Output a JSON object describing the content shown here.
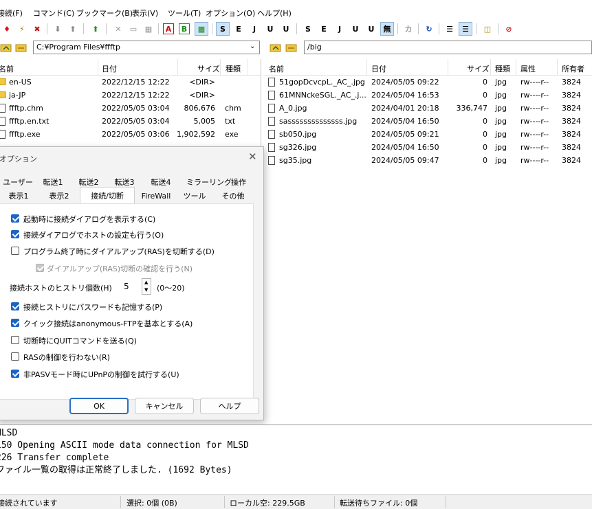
{
  "menu": [
    "接続(F)",
    "コマンド(C)",
    "ブックマーク(B)",
    "表示(V)",
    "ツール(T)",
    "オプション(O)",
    "ヘルプ(H)"
  ],
  "toolbar": {
    "text_buttons": [
      "A",
      "B",
      "S",
      "E",
      "J",
      "U",
      "U",
      "無",
      "カ",
      "S",
      "E",
      "J",
      "U",
      "U"
    ]
  },
  "local_path": "C:¥Program Files¥ffftp",
  "remote_path": "/big",
  "local_pane": {
    "columns": [
      "名前",
      "日付",
      "サイズ",
      "種類"
    ],
    "rows": [
      {
        "name": "en-US",
        "date": "2022/12/15 12:22",
        "size": "<DIR>",
        "type": "",
        "icon": "folder"
      },
      {
        "name": "ja-JP",
        "date": "2022/12/15 12:22",
        "size": "<DIR>",
        "type": "",
        "icon": "folder"
      },
      {
        "name": "ffftp.chm",
        "date": "2022/05/05 03:04",
        "size": "806,676",
        "type": "chm",
        "icon": "file"
      },
      {
        "name": "ffftp.en.txt",
        "date": "2022/05/05 03:04",
        "size": "5,005",
        "type": "txt",
        "icon": "file"
      },
      {
        "name": "ffftp.exe",
        "date": "2022/05/05 03:06",
        "size": "1,902,592",
        "type": "exe",
        "icon": "file"
      }
    ]
  },
  "remote_pane": {
    "columns": [
      "名前",
      "日付",
      "サイズ",
      "種類",
      "属性",
      "所有者"
    ],
    "rows": [
      {
        "name": "51gopDcvcpL._AC_.jpg",
        "date": "2024/05/05 09:22",
        "size": "0",
        "type": "jpg",
        "attr": "rw----r--",
        "owner": "3824"
      },
      {
        "name": "61MNNckeSGL._AC_.j...",
        "date": "2024/05/04 16:53",
        "size": "0",
        "type": "jpg",
        "attr": "rw----r--",
        "owner": "3824"
      },
      {
        "name": "A_0.jpg",
        "date": "2024/04/01 20:18",
        "size": "336,747",
        "type": "jpg",
        "attr": "rw----r--",
        "owner": "3824"
      },
      {
        "name": "sassssssssssssss.jpg",
        "date": "2024/05/04 16:50",
        "size": "0",
        "type": "jpg",
        "attr": "rw----r--",
        "owner": "3824"
      },
      {
        "name": "sb050.jpg",
        "date": "2024/05/05 09:21",
        "size": "0",
        "type": "jpg",
        "attr": "rw----r--",
        "owner": "3824"
      },
      {
        "name": "sg326.jpg",
        "date": "2024/05/04 16:50",
        "size": "0",
        "type": "jpg",
        "attr": "rw----r--",
        "owner": "3824"
      },
      {
        "name": "sg35.jpg",
        "date": "2024/05/05 09:47",
        "size": "0",
        "type": "jpg",
        "attr": "rw----r--",
        "owner": "3824"
      }
    ]
  },
  "dialog": {
    "title": "オプション",
    "tabs_row1": [
      "ユーザー",
      "転送1",
      "転送2",
      "転送3",
      "転送4",
      "ミラーリング",
      "操作"
    ],
    "tabs_row2": [
      "表示1",
      "表示2",
      "接続/切断",
      "FireWall",
      "ツール",
      "その他"
    ],
    "active_tab": "接続/切断",
    "options": [
      {
        "label": "起動時に接続ダイアログを表示する(C)",
        "state": "checked"
      },
      {
        "label": "接続ダイアログでホストの設定も行う(O)",
        "state": "checked"
      },
      {
        "label": "プログラム終了時にダイアルアップ(RAS)を切断する(D)",
        "state": "unchecked"
      },
      {
        "label": "ダイアルアップ(RAS)切断の確認を行う(N)",
        "state": "disabled"
      }
    ],
    "history_label": "接続ホストのヒストリ個数(H)",
    "history_value": "5",
    "history_range": "(0～20)",
    "options2": [
      {
        "label": "接続ヒストリにパスワードも記憶する(P)",
        "state": "checked"
      },
      {
        "label": "クイック接続はanonymous-FTPを基本とする(A)",
        "state": "checked"
      },
      {
        "label": "切断時にQUITコマンドを送る(Q)",
        "state": "unchecked"
      },
      {
        "label": "RASの制御を行わない(R)",
        "state": "unchecked"
      },
      {
        "label": "非PASVモード時にUPnPの制御を試行する(U)",
        "state": "checked"
      }
    ],
    "ok": "OK",
    "cancel": "キャンセル",
    "help": "ヘルプ"
  },
  "log": [
    "MLSD",
    "150 Opening ASCII mode data connection for MLSD",
    "226 Transfer complete",
    "ファイル一覧の取得は正常終了しました. (1692 Bytes)"
  ],
  "status": {
    "connection": "接続されています",
    "selection": "選択: 0個 (0B)",
    "local_free": "ローカル空: 229.5GB",
    "queue": "転送待ちファイル: 0個"
  }
}
